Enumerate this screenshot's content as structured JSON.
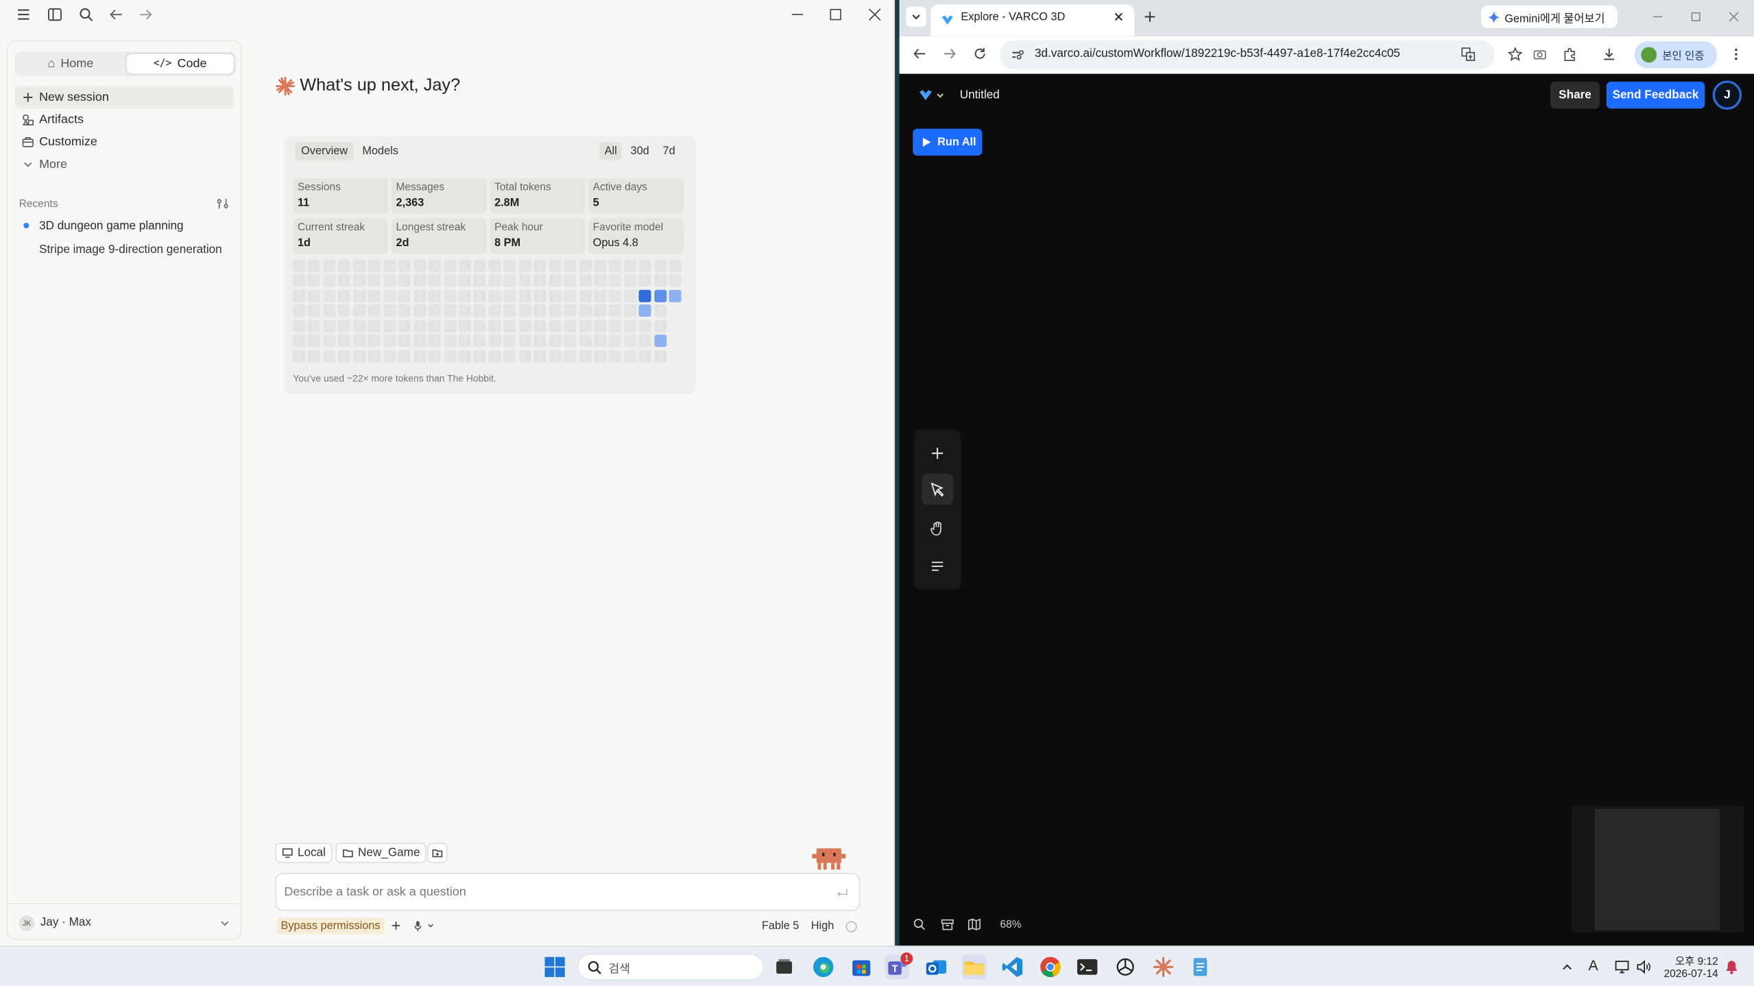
{
  "left_app": {
    "nav_tabs": [
      {
        "label": "Home"
      },
      {
        "label": "Code"
      }
    ],
    "menu": [
      {
        "label": "New session"
      },
      {
        "label": "Artifacts"
      },
      {
        "label": "Customize"
      },
      {
        "label": "More"
      }
    ],
    "recents_label": "Recents",
    "recents": [
      {
        "label": "3D dungeon game planning"
      },
      {
        "label": "Stripe image 9-direction generation"
      }
    ],
    "user": {
      "initials": "JK",
      "name": "Jay · Max"
    },
    "greeting": "What's up next, Jay?",
    "stats_tabs": [
      {
        "label": "Overview"
      },
      {
        "label": "Models"
      }
    ],
    "range_tabs": [
      {
        "label": "All"
      },
      {
        "label": "30d"
      },
      {
        "label": "7d"
      }
    ],
    "stats": [
      {
        "label": "Sessions",
        "value": "11"
      },
      {
        "label": "Messages",
        "value": "2,363"
      },
      {
        "label": "Total tokens",
        "value": "2.8M"
      },
      {
        "label": "Active days",
        "value": "5"
      },
      {
        "label": "Current streak",
        "value": "1d"
      },
      {
        "label": "Longest streak",
        "value": "2d"
      },
      {
        "label": "Peak hour",
        "value": "8 PM"
      },
      {
        "label": "Favorite model",
        "value": "Opus 4.8"
      }
    ],
    "heatmap_note": "You've used ~22× more tokens than The Hobbit.",
    "chips": {
      "local": "Local",
      "folder": "New_Game"
    },
    "composer_placeholder": "Describe a task or ask a question",
    "bypass": "Bypass permissions",
    "model": "Fable 5",
    "effort": "High"
  },
  "browser": {
    "tab_title": "Explore - VARCO 3D",
    "gemini": "Gemini에게 물어보기",
    "url": "3d.varco.ai/customWorkflow/1892219c-b53f-4497-a1e8-17f4e2cc4c05",
    "verify": "본인 인증",
    "doc_title": "Untitled",
    "share": "Share",
    "feedback": "Send Feedback",
    "avatar": "J",
    "run_all": "Run All",
    "zoom": "68%"
  },
  "taskbar": {
    "search": "검색",
    "time": "오후 9:12",
    "date": "2026-07-14",
    "badge": "1",
    "ime": "A"
  },
  "colors": {
    "accent_blue": "#1e6bff",
    "claude_orange": "#d97757",
    "heat_dark": "#2f6ed8",
    "heat_mid": "#5b8fe8",
    "heat_light": "#8db1f0"
  }
}
